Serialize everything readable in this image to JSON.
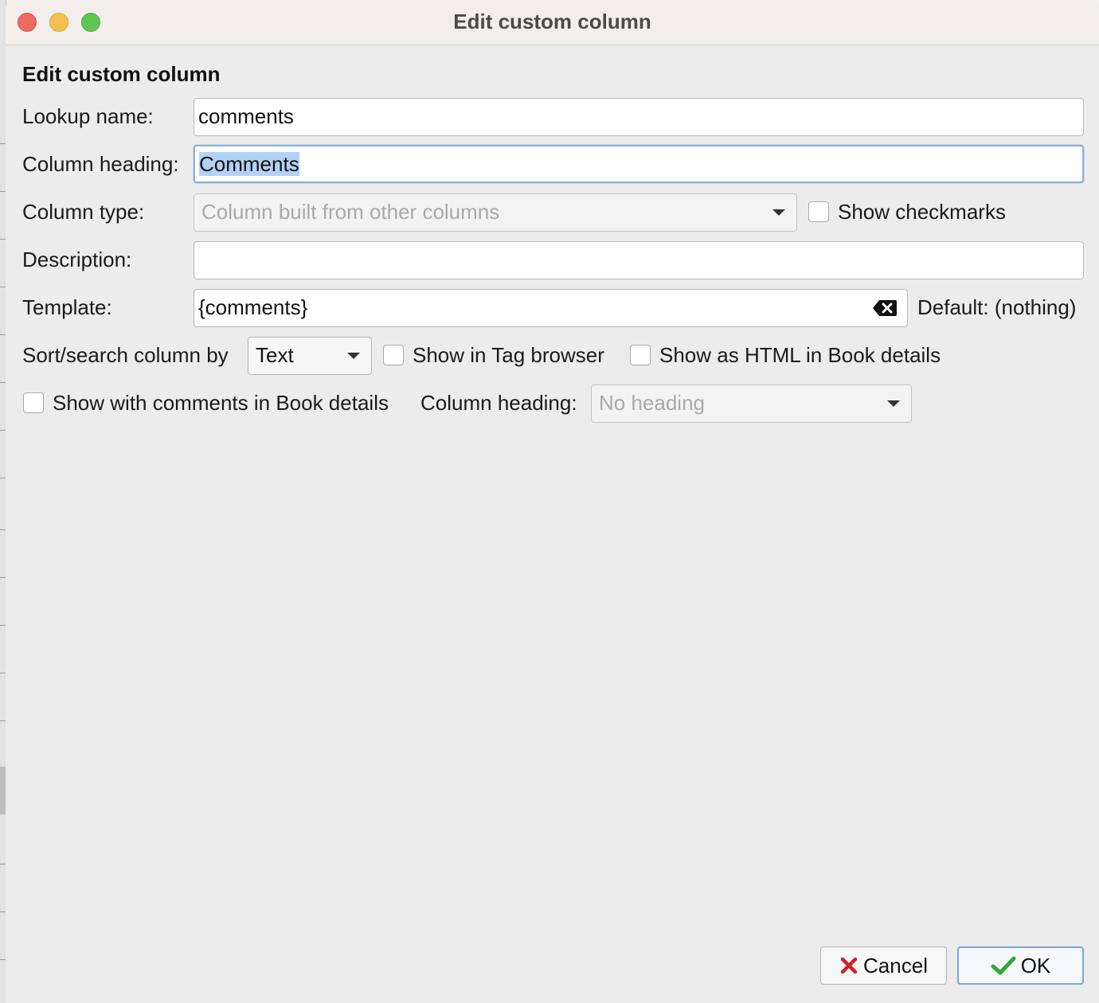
{
  "window": {
    "title": "Edit custom column"
  },
  "form": {
    "heading": "Edit custom column",
    "lookup_name": {
      "label": "Lookup name:",
      "value": "comments"
    },
    "column_heading": {
      "label": "Column heading:",
      "value": "Comments"
    },
    "column_type": {
      "label": "Column type:",
      "value": "Column built from other columns"
    },
    "show_checkmarks": {
      "label": "Show checkmarks",
      "checked": false
    },
    "description": {
      "label": "Description:",
      "value": ""
    },
    "template": {
      "label": "Template:",
      "value": "{comments}",
      "default_label": "Default: (nothing)"
    },
    "sort_search": {
      "label": "Sort/search column by",
      "value": "Text"
    },
    "show_in_tag_browser": {
      "label": "Show in Tag browser",
      "checked": false
    },
    "show_as_html": {
      "label": "Show as HTML in Book details",
      "checked": false
    },
    "show_with_comments": {
      "label": "Show with comments in Book details",
      "checked": false
    },
    "comments_heading": {
      "label": "Column heading:",
      "value": "No heading"
    }
  },
  "buttons": {
    "cancel": "Cancel",
    "ok": "OK"
  },
  "colors": {
    "cancel_icon": "#d0202a",
    "ok_icon": "#2fa836",
    "focus_ring": "#8fb0d9",
    "selection": "#b3d1f5"
  }
}
